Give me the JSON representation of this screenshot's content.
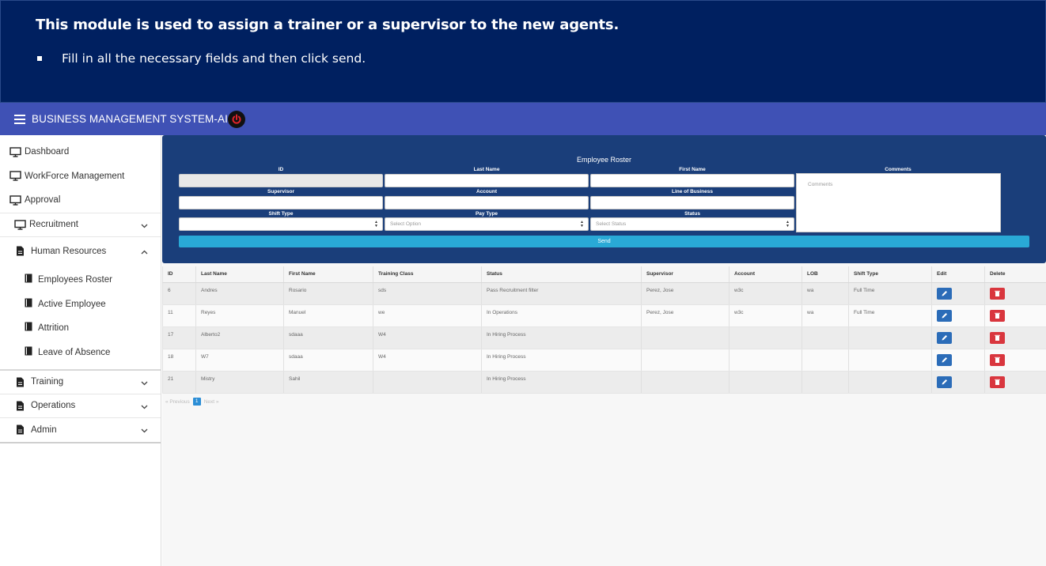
{
  "banner": {
    "title": "This module is used to assign a trainer or a supervisor to the new agents.",
    "bullet": "Fill in all the necessary fields and then click send."
  },
  "appbar": {
    "title": "BUSINESS MANAGEMENT SYSTEM-AI",
    "menu_icon": "hamburger-icon",
    "power_icon": "power-icon"
  },
  "sidebar": {
    "top_items": [
      {
        "label": "Dashboard",
        "icon": "monitor-icon"
      },
      {
        "label": "WorkForce Management",
        "icon": "monitor-icon"
      },
      {
        "label": "Approval",
        "icon": "monitor-icon"
      }
    ],
    "groups": [
      {
        "label": "Recruitment",
        "icon": "monitor-icon",
        "expanded": false
      },
      {
        "label": "Human Resources",
        "icon": "document-icon",
        "expanded": true
      },
      {
        "label": "Training",
        "icon": "document-icon",
        "expanded": false
      },
      {
        "label": "Operations",
        "icon": "document-icon",
        "expanded": false
      },
      {
        "label": "Admin",
        "icon": "document-icon",
        "expanded": false
      }
    ],
    "hr_items": [
      {
        "label": "Employees Roster"
      },
      {
        "label": "Active Employee"
      },
      {
        "label": "Attrition"
      },
      {
        "label": "Leave of Absence"
      }
    ]
  },
  "form": {
    "title": "Employee Roster",
    "labels": {
      "id": "ID",
      "last_name": "Last Name",
      "first_name": "First Name",
      "comments": "Comments",
      "supervisor": "Supervisor",
      "account": "Account",
      "line_of_business": "Line of Business",
      "shift_type": "Shift Type",
      "pay_type": "Pay Type",
      "status": "Status"
    },
    "values": {
      "id": "",
      "last_name": "",
      "first_name": "",
      "supervisor": "",
      "account": "",
      "line_of_business": "",
      "shift_type": ""
    },
    "placeholders": {
      "comments": "Comments",
      "pay_type": "Select Option",
      "status": "Select Status"
    },
    "send_label": "Send"
  },
  "table": {
    "headers": [
      "ID",
      "Last Name",
      "First Name",
      "Training Class",
      "Status",
      "Supervisor",
      "Account",
      "LOB",
      "Shift Type",
      "Edit",
      "Delete"
    ],
    "rows": [
      [
        "6",
        "Andres",
        "Rosario",
        "sds",
        "Pass Recruitment filter",
        "Perez, Jose",
        "w3c",
        "wa",
        "Full Time"
      ],
      [
        "11",
        "Reyes",
        "Manuel",
        "we",
        "In Operations",
        "Perez, Jose",
        "w3c",
        "wa",
        "Full Time"
      ],
      [
        "17",
        "Alberto2",
        "sdaaa",
        "W4",
        "In Hiring Process",
        "",
        "",
        "",
        ""
      ],
      [
        "18",
        "W7",
        "sdaaa",
        "W4",
        "In Hiring Process",
        "",
        "",
        "",
        ""
      ],
      [
        "21",
        "Mistry",
        "Sahil",
        "",
        "In Hiring Process",
        "",
        "",
        "",
        ""
      ]
    ]
  },
  "pager": {
    "previous": "Previous",
    "current": "1",
    "next": "Next"
  },
  "colors": {
    "banner": "#002060",
    "appbar": "#3f51b5",
    "form_panel": "#1a3e7a",
    "send": "#29a9d6",
    "edit": "#2b6cb8",
    "delete": "#d9363e"
  }
}
